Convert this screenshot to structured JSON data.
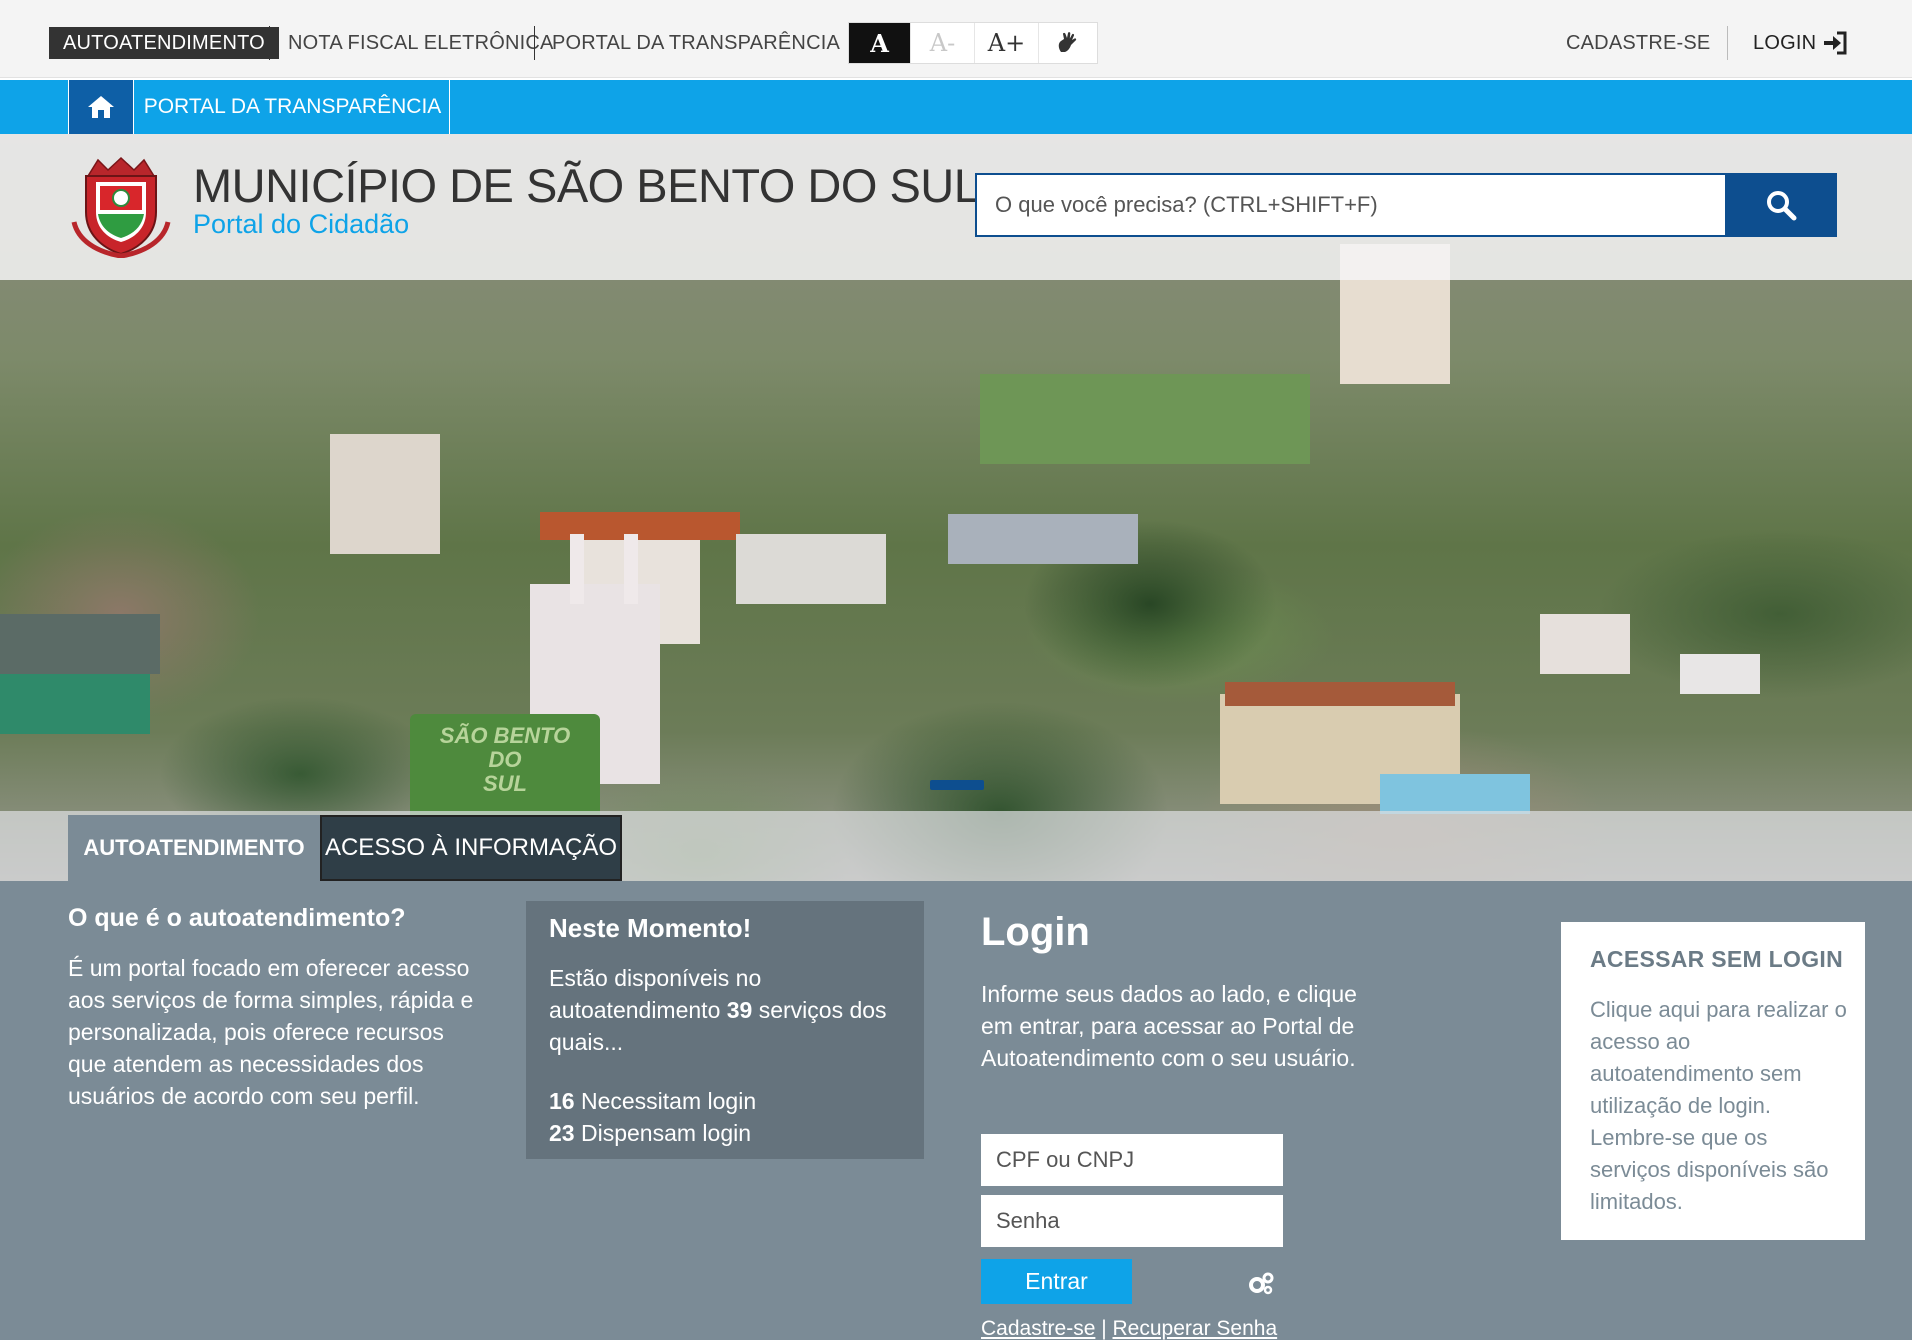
{
  "topbar": {
    "items": [
      "AUTOATENDIMENTO",
      "NOTA FISCAL ELETRÔNICA",
      "PORTAL DA TRANSPARÊNCIA"
    ],
    "font_controls": [
      "A",
      "A-",
      "A+"
    ],
    "accessibility_icon": "sign-language-icon",
    "cadastre": "CADASTRE-SE",
    "login": "LOGIN"
  },
  "nav": {
    "home_icon": "home-icon",
    "breadcrumb": "PORTAL DA TRANSPARÊNCIA"
  },
  "header": {
    "title": "MUNICÍPIO DE SÃO BENTO DO SUL",
    "subtitle": "Portal do Cidadão",
    "search_placeholder": "O que você precisa? (CTRL+SHIFT+F)",
    "search_icon": "search-icon"
  },
  "tabs": [
    "AUTOATENDIMENTO",
    "ACESSO À INFORMAÇÃO"
  ],
  "about": {
    "title": "O que é o autoatendimento?",
    "text": "É um portal focado em oferecer acesso aos serviços de forma simples, rápida e personalizada, pois oferece recursos que atendem as necessidades dos usuários de acordo com seu perfil."
  },
  "moment": {
    "title": "Neste Momento!",
    "text_before": "Estão disponíveis no autoatendimento ",
    "total": "39",
    "text_after": " serviços dos quais...",
    "need_count": "16",
    "need_label": " Necessitam login",
    "free_count": "23",
    "free_label": " Dispensam login"
  },
  "login": {
    "title": "Login",
    "text": "Informe seus dados ao lado, e clique em entrar, para acessar ao Portal de Autoatendimento com o seu usuário.",
    "user_placeholder": "CPF ou CNPJ",
    "pass_placeholder": "Senha",
    "submit": "Entrar",
    "register_link": "Cadastre-se",
    "link_sep": " | ",
    "recover_link": "Recuperar Senha",
    "settings_icon": "gears-icon"
  },
  "nologin": {
    "title": "ACESSAR SEM LOGIN",
    "text": "Clique aqui para realizar o acesso ao autoatendimento sem utilização de login. Lembre-se que os serviços disponíveis são limitados."
  },
  "hero": {
    "sign_text": [
      "SÃO BENTO",
      "DO",
      "SUL"
    ]
  }
}
